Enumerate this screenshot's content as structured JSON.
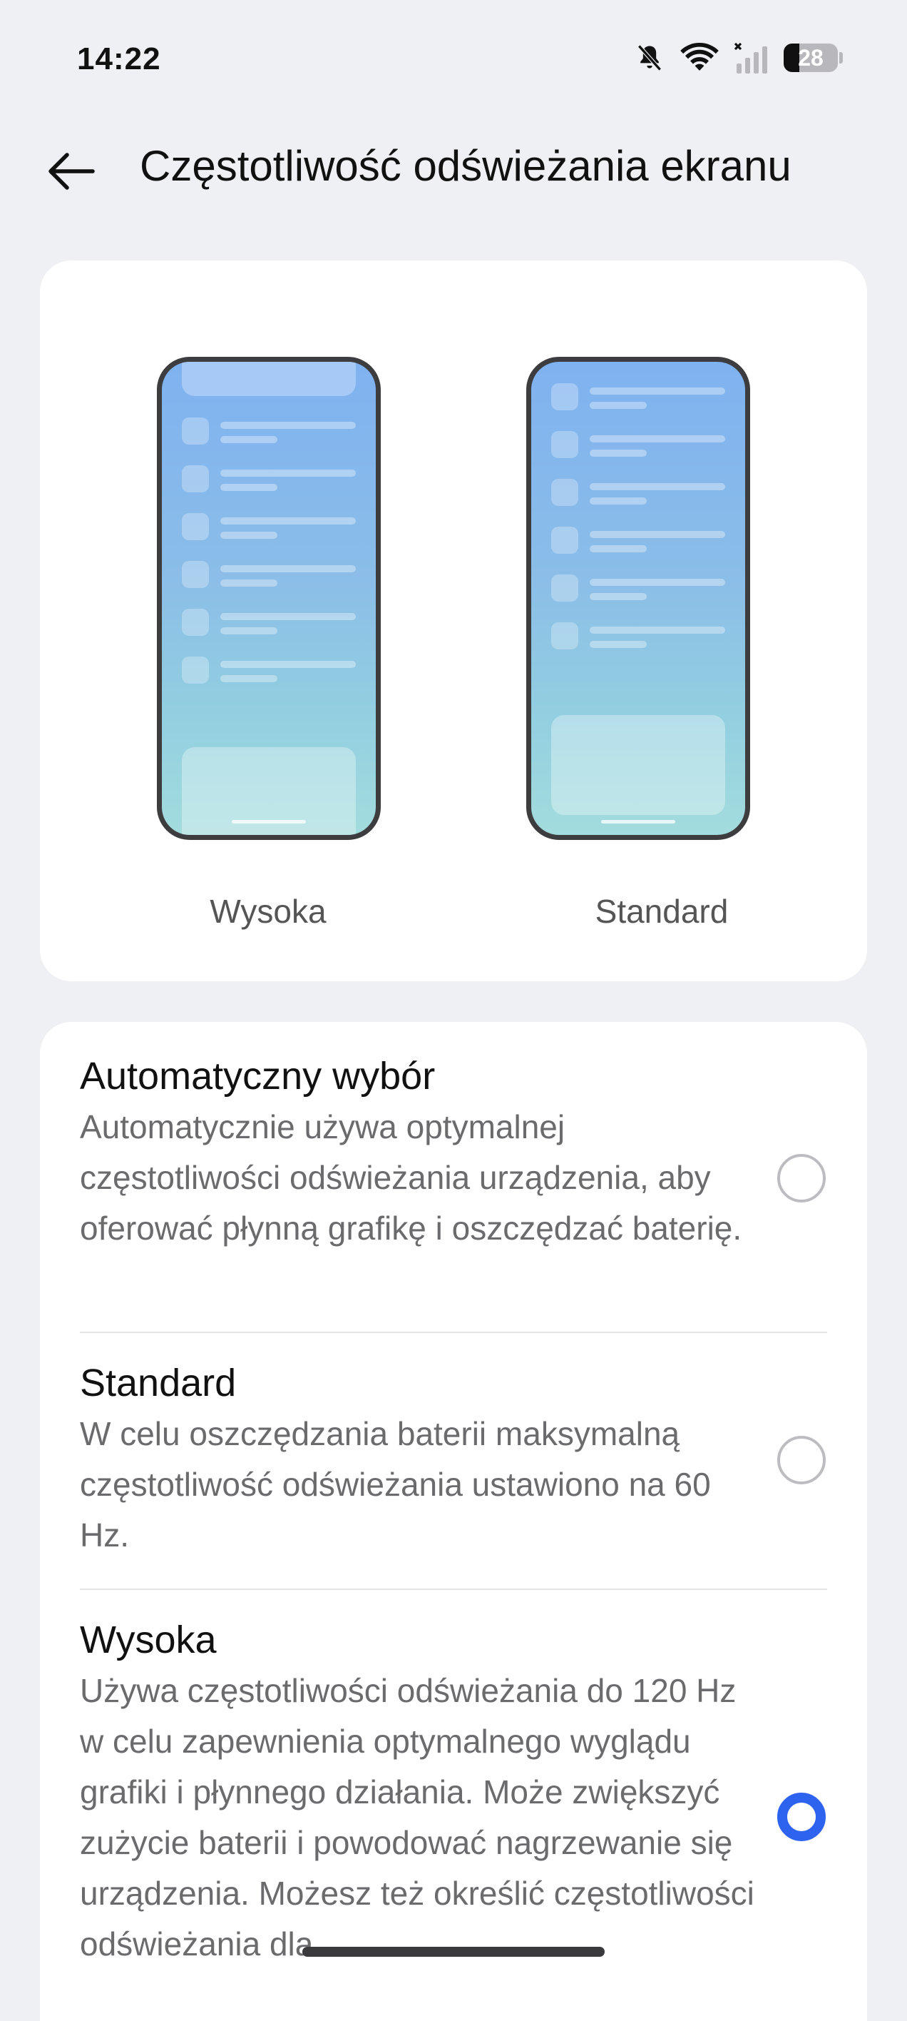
{
  "status_bar": {
    "time": "14:22",
    "battery_level": "28",
    "icons": [
      "bell-muted-icon",
      "wifi-icon",
      "signal-icon",
      "battery-icon"
    ]
  },
  "header": {
    "title": "Częstotliwość odświeżania ekranu",
    "back_icon": "arrow-left-icon"
  },
  "preview": {
    "high_label": "Wysoka",
    "standard_label": "Standard"
  },
  "options": [
    {
      "title": "Automatyczny wybór",
      "description": "Automatycznie używa optymalnej częstotliwości odświeżania urządzenia, aby oferować płynną grafikę i oszczędzać baterię.",
      "selected": false
    },
    {
      "title": "Standard",
      "description": "W celu oszczędzania baterii maksymalną częstotliwość odświeżania ustawiono na 60 Hz.",
      "selected": false
    },
    {
      "title": "Wysoka",
      "description": "Używa częstotliwości odświeżania do 120 Hz w celu zapewnienia optymalnego wyglądu grafiki i płynnego działania. Może zwiększyć zużycie baterii i powodować nagrzewanie się urządzenia. Możesz też określić częstotliwości odświeżania dla",
      "selected": true
    }
  ],
  "colors": {
    "accent": "#2E63F0",
    "background": "#EFF0F3",
    "card": "#FFFFFF"
  }
}
